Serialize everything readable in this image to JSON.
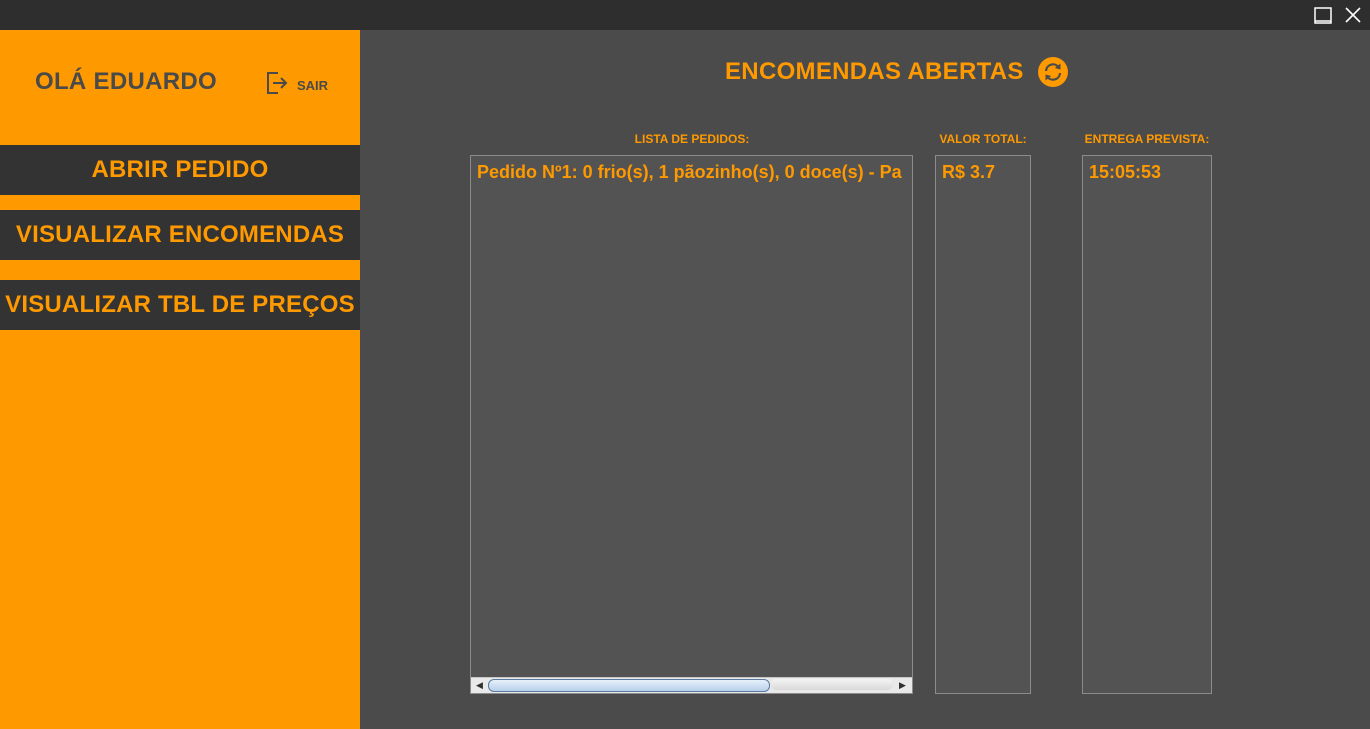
{
  "window": {
    "maximize_icon": "maximize-icon",
    "close_icon": "close-icon"
  },
  "sidebar": {
    "greeting": "OLÁ EDUARDO",
    "logout_label": "SAIR",
    "logout_icon": "logout-icon",
    "items": [
      {
        "label": "ABRIR PEDIDO"
      },
      {
        "label": "VISUALIZAR ENCOMENDAS"
      },
      {
        "label": "VISUALIZAR TBL DE PREÇOS"
      }
    ]
  },
  "main": {
    "title": "ENCOMENDAS ABERTAS",
    "refresh_icon": "refresh-icon",
    "columns": {
      "orders_header": "LISTA DE PEDIDOS:",
      "total_header": "VALOR TOTAL:",
      "delivery_header": "ENTREGA PREVISTA:"
    },
    "orders": [
      {
        "description": "Pedido Nº1: 0 frio(s), 1 pãozinho(s), 0 doce(s)  -   Pa",
        "total": "R$ 3.7",
        "delivery": "15:05:53"
      }
    ]
  },
  "colors": {
    "accent": "#ff9900",
    "sidebar_bg": "#ff9900",
    "nav_bg": "#333333",
    "main_bg": "#4b4b4b",
    "titlebar_bg": "#2e2e2e",
    "panel_bg": "#535353",
    "greeting_text": "#4a4a4a"
  }
}
